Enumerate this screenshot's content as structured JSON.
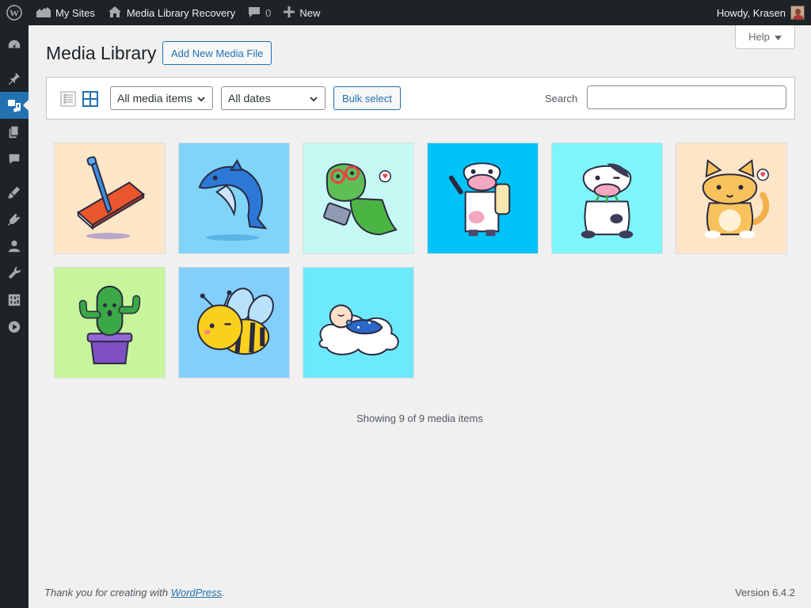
{
  "adminbar": {
    "my_sites": "My Sites",
    "site_name": "Media Library Recovery",
    "comments_count": "0",
    "new_label": "New",
    "howdy": "Howdy, Krasen"
  },
  "sidebar": {
    "items": [
      {
        "icon": "dashboard-icon"
      },
      {
        "icon": "pin-icon"
      },
      {
        "icon": "media-icon",
        "current": true
      },
      {
        "icon": "pages-icon"
      },
      {
        "icon": "comments-icon"
      },
      {
        "icon": "appearance-icon"
      },
      {
        "icon": "plugins-icon"
      },
      {
        "icon": "users-icon"
      },
      {
        "icon": "tools-icon"
      },
      {
        "icon": "settings-icon"
      },
      {
        "icon": "collapse-icon"
      }
    ]
  },
  "help": {
    "label": "Help"
  },
  "page": {
    "title": "Media Library",
    "add_new": "Add New Media File"
  },
  "toolbar": {
    "type_filter": "All media items",
    "date_filter": "All dates",
    "bulk_select": "Bulk select",
    "search_label": "Search",
    "search_value": ""
  },
  "media": [
    {
      "subject": "notebook with pen",
      "bg": "#fde6c8"
    },
    {
      "subject": "dolphin",
      "bg": "#80d4f8"
    },
    {
      "subject": "dinosaur with tablet",
      "bg": "#c6f9f3"
    },
    {
      "subject": "cow with milk bottle",
      "bg": "#00c3f8"
    },
    {
      "subject": "cow eating grass",
      "bg": "#7ff4fb"
    },
    {
      "subject": "cat",
      "bg": "#fde6c8"
    },
    {
      "subject": "cactus",
      "bg": "#c8f59b"
    },
    {
      "subject": "bee",
      "bg": "#83cffc"
    },
    {
      "subject": "baby on cloud",
      "bg": "#6de9fd"
    }
  ],
  "status": {
    "showing": "Showing 9 of 9 media items"
  },
  "footer": {
    "thanks_prefix": "Thank you for creating with ",
    "wordpress_link": "WordPress",
    "thanks_suffix": ".",
    "version": "Version 6.4.2"
  }
}
